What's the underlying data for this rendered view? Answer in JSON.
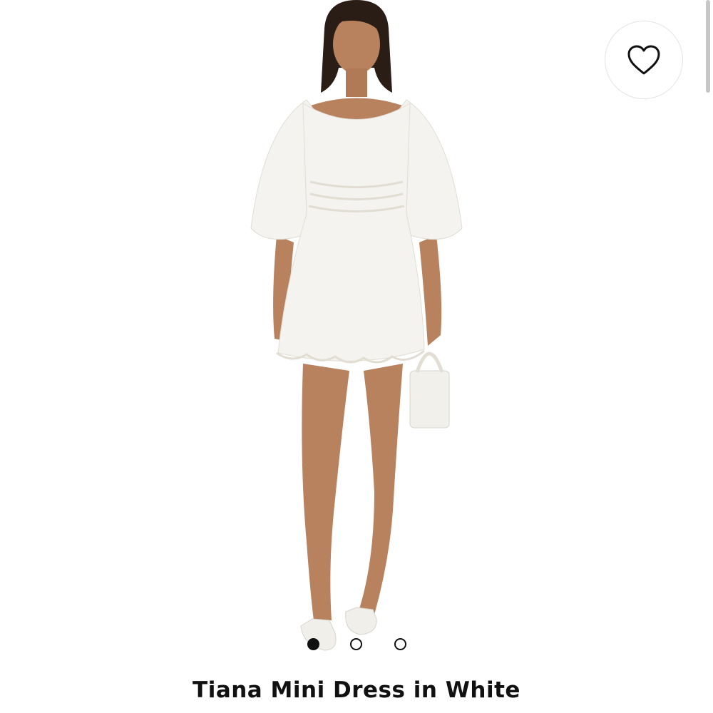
{
  "product": {
    "title": "Tiana Mini Dress in White",
    "image_alt": "Model wearing white mini dress with puff sleeves"
  },
  "wishlist": {
    "icon": "heart-icon"
  },
  "carousel": {
    "total": 3,
    "active_index": 0
  },
  "colors": {
    "background": "#ffffff",
    "text": "#111111",
    "dress": "#f4f3ef",
    "skin": "#b9825e",
    "hair": "#2a1d16"
  }
}
